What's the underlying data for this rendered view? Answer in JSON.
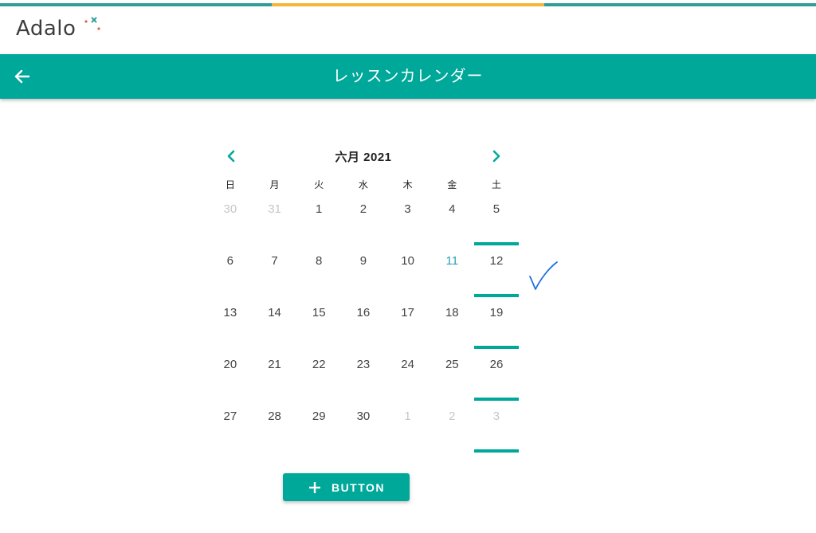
{
  "colors": {
    "primary": "#00A89A",
    "progress_segments": [
      "#2F9E96",
      "#F4B73A",
      "#F4B73A",
      "#2F9E96"
    ],
    "accent_today": "#2a9fb5",
    "checkmark": "#1E6FE0"
  },
  "progress_bar": {
    "segment_fractions": [
      0.333,
      0.167,
      0.167,
      0.333
    ]
  },
  "brand": {
    "logo_text": "Adalo"
  },
  "appbar": {
    "title": "レッスンカレンダー",
    "back_icon": "arrow-left-icon"
  },
  "calendar": {
    "month_label": "六月 2021",
    "prev_icon": "chevron-left-icon",
    "next_icon": "chevron-right-icon",
    "weekdays": [
      "日",
      "月",
      "火",
      "水",
      "木",
      "金",
      "土"
    ],
    "weeks": [
      [
        {
          "d": "30",
          "other": true
        },
        {
          "d": "31",
          "other": true
        },
        {
          "d": "1"
        },
        {
          "d": "2"
        },
        {
          "d": "3"
        },
        {
          "d": "4"
        },
        {
          "d": "5",
          "event": true
        }
      ],
      [
        {
          "d": "6"
        },
        {
          "d": "7"
        },
        {
          "d": "8"
        },
        {
          "d": "9"
        },
        {
          "d": "10"
        },
        {
          "d": "11",
          "today": true
        },
        {
          "d": "12",
          "event": true
        }
      ],
      [
        {
          "d": "13"
        },
        {
          "d": "14"
        },
        {
          "d": "15"
        },
        {
          "d": "16"
        },
        {
          "d": "17"
        },
        {
          "d": "18"
        },
        {
          "d": "19",
          "event": true
        }
      ],
      [
        {
          "d": "20"
        },
        {
          "d": "21"
        },
        {
          "d": "22"
        },
        {
          "d": "23"
        },
        {
          "d": "24"
        },
        {
          "d": "25"
        },
        {
          "d": "26",
          "event": true
        }
      ],
      [
        {
          "d": "27"
        },
        {
          "d": "28"
        },
        {
          "d": "29"
        },
        {
          "d": "30"
        },
        {
          "d": "1",
          "other": true
        },
        {
          "d": "2",
          "other": true
        },
        {
          "d": "3",
          "other": true,
          "event": true
        }
      ]
    ]
  },
  "annotation": {
    "icon": "handwritten-checkmark-icon"
  },
  "action_button": {
    "label": "BUTTON",
    "icon": "plus-icon"
  }
}
